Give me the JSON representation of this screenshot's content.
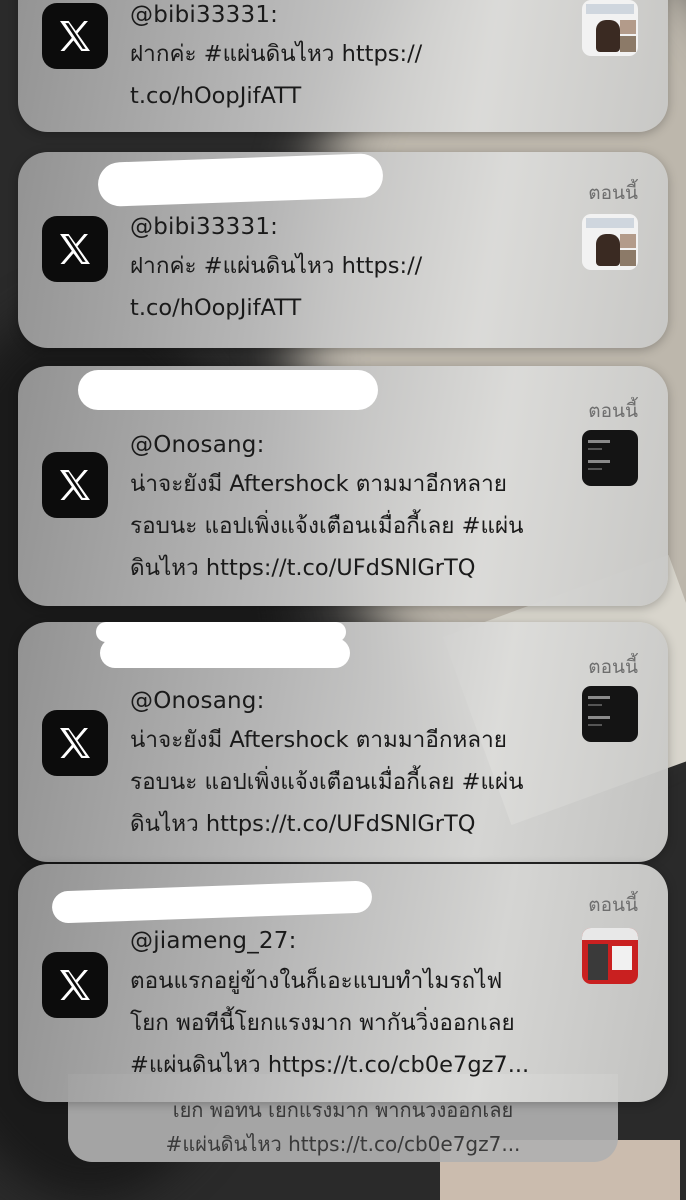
{
  "notifications": [
    {
      "app_icon": "x-logo-icon",
      "time": "",
      "sender": "@bibi33331:",
      "message": "ฝากค่ะ #แผ่นดินไหว https://\nt.co/hOopJifATT",
      "thumbnail": "photo-thumbnail"
    },
    {
      "app_icon": "x-logo-icon",
      "time": "ตอนนี้",
      "sender": "@bibi33331:",
      "message": "ฝากค่ะ #แผ่นดินไหว https://\nt.co/hOopJifATT",
      "thumbnail": "photo-thumbnail"
    },
    {
      "app_icon": "x-logo-icon",
      "time": "ตอนนี้",
      "sender": "@Onosang:",
      "message": "น่าจะยังมี Aftershock ตามมาอีกหลาย\nรอบนะ แอปเพิ่งแจ้งเตือนเมื่อกี้เลย #แผ่น\nดินไหว https://t.co/UFdSNlGrTQ",
      "thumbnail": "dark-screenshot-thumbnail"
    },
    {
      "app_icon": "x-logo-icon",
      "time": "ตอนนี้",
      "sender": "@Onosang:",
      "message": "น่าจะยังมี Aftershock ตามมาอีกหลาย\nรอบนะ แอปเพิ่งแจ้งเตือนเมื่อกี้เลย #แผ่น\nดินไหว https://t.co/UFdSNlGrTQ",
      "thumbnail": "dark-screenshot-thumbnail"
    },
    {
      "app_icon": "x-logo-icon",
      "time": "ตอนนี้",
      "sender": "@jiameng_27:",
      "message": "ตอนแรกอยู่ข้างในก็เอะแบบทำไมรถไฟ\nโยก พอทีนี้โยกแรงมาก พากันวิ่งออกเลย\n#แผ่นดินไหว https://t.co/cb0e7gz7...",
      "thumbnail": "train-photo-thumbnail"
    }
  ],
  "stacked_behind": {
    "line1": "เยก พอทน เยกแรงมาก พากนวงออกเลย",
    "line2": "#แผ่นดินไหว https://t.co/cb0e7gz7..."
  },
  "colors": {
    "redaction": "#ffffff",
    "icon_bg": "#0c0c0c",
    "time_text": "#6e6e6e"
  }
}
